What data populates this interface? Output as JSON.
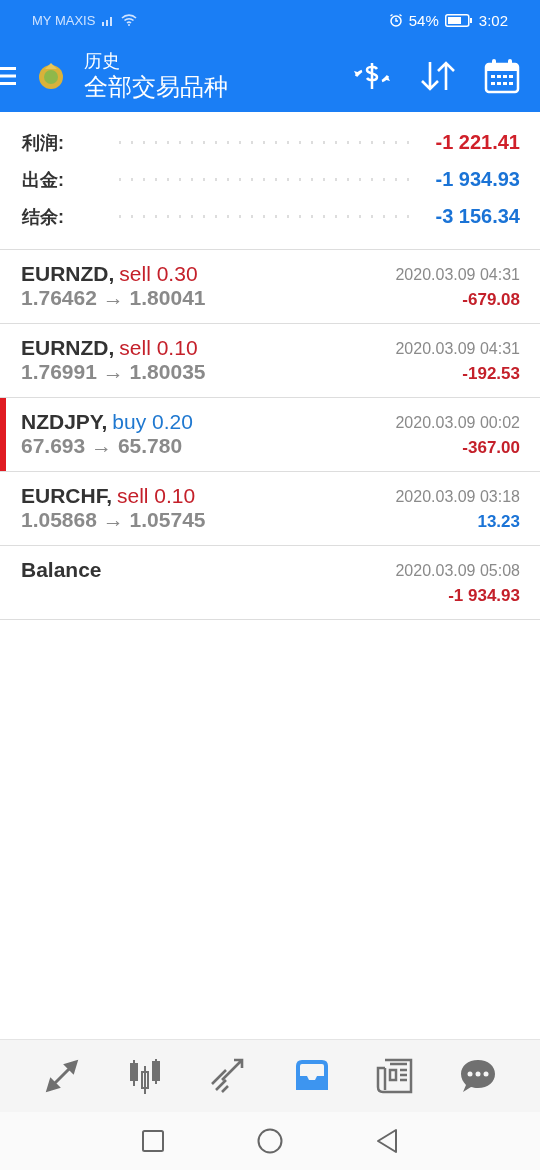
{
  "status_bar": {
    "carrier": "MY MAXIS",
    "battery": "54%",
    "time": "3:02"
  },
  "header": {
    "title": "历史",
    "subtitle": "全部交易品种"
  },
  "summary": [
    {
      "label": "利润:",
      "value": "-1 221.41",
      "color": "#d0202a"
    },
    {
      "label": "出金:",
      "value": "-1 934.93",
      "color": "#1a73d6"
    },
    {
      "label": "结余:",
      "value": "-3 156.34",
      "color": "#1a73d6"
    }
  ],
  "deals": [
    {
      "kind": "trade",
      "symbol": "EURNZD,",
      "side": "sell",
      "volume": "0.30",
      "prices": "1.76462 → 1.80041",
      "time": "2020.03.09 04:31",
      "profit": "-679.08",
      "gain": false,
      "marked": false
    },
    {
      "kind": "trade",
      "symbol": "EURNZD,",
      "side": "sell",
      "volume": "0.10",
      "prices": "1.76991 → 1.80035",
      "time": "2020.03.09 04:31",
      "profit": "-192.53",
      "gain": false,
      "marked": false
    },
    {
      "kind": "trade",
      "symbol": "NZDJPY,",
      "side": "buy",
      "volume": "0.20",
      "prices": "67.693 → 65.780",
      "time": "2020.03.09 00:02",
      "profit": "-367.00",
      "gain": false,
      "marked": true
    },
    {
      "kind": "trade",
      "symbol": "EURCHF,",
      "side": "sell",
      "volume": "0.10",
      "prices": "1.05868 → 1.05745",
      "time": "2020.03.09 03:18",
      "profit": "13.23",
      "gain": true,
      "marked": false
    },
    {
      "kind": "balance",
      "symbol": "Balance",
      "time": "2020.03.09 05:08",
      "profit": "-1 934.93",
      "gain": false,
      "marked": false
    }
  ],
  "bottom_nav": [
    {
      "kind": "quotes",
      "selected": false
    },
    {
      "kind": "chart",
      "selected": false
    },
    {
      "kind": "trade",
      "selected": false
    },
    {
      "kind": "history",
      "selected": true
    },
    {
      "kind": "news",
      "selected": false
    },
    {
      "kind": "chat",
      "selected": false
    }
  ]
}
